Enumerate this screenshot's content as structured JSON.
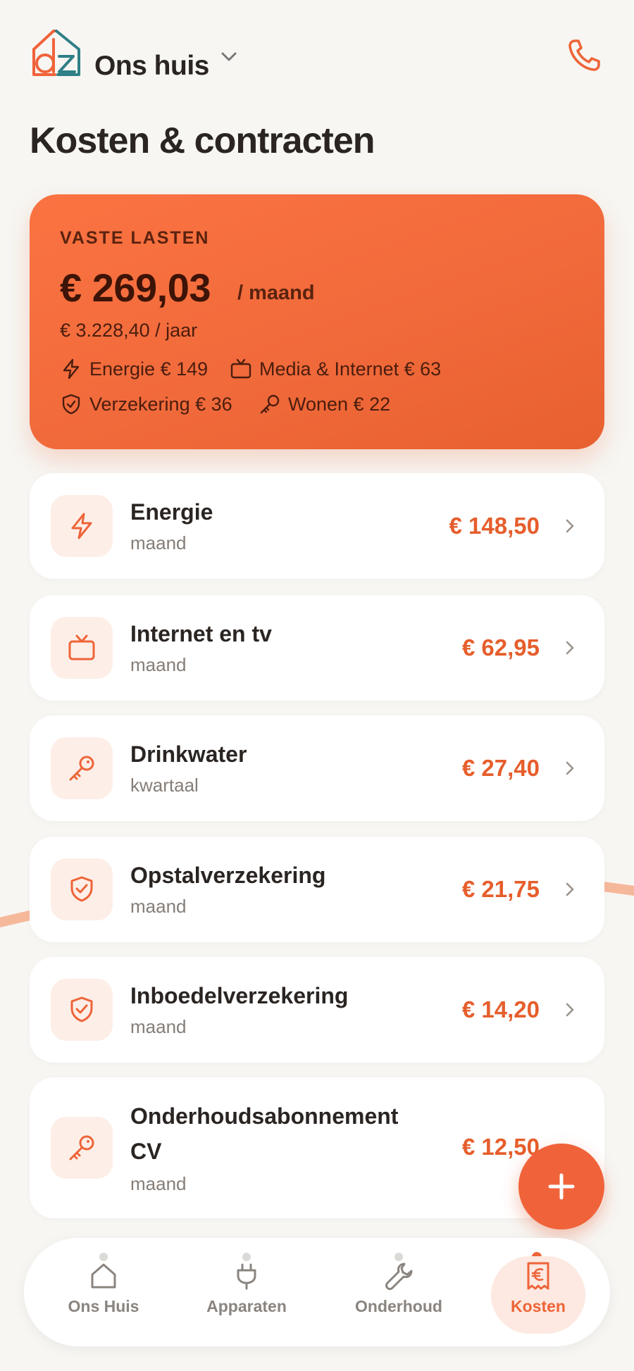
{
  "header": {
    "home_name": "Ons huis",
    "logo_letters": "dz"
  },
  "page": {
    "title": "Kosten & contracten"
  },
  "summary": {
    "label": "VASTE LASTEN",
    "amount": "€ 269,03",
    "period": "/ maand",
    "yearly": "€ 3.228,40 / jaar",
    "categories": [
      {
        "icon": "bolt-icon",
        "label": "Energie € 149"
      },
      {
        "icon": "tv-icon",
        "label": "Media & Internet € 63"
      },
      {
        "icon": "shield-icon",
        "label": "Verzekering € 36"
      },
      {
        "icon": "key-icon",
        "label": "Wonen € 22"
      }
    ]
  },
  "contracts": [
    {
      "icon": "bolt-icon",
      "title": "Energie",
      "period": "maand",
      "amount": "€ 148,50"
    },
    {
      "icon": "tv-icon",
      "title": "Internet en tv",
      "period": "maand",
      "amount": "€ 62,95"
    },
    {
      "icon": "key-icon",
      "title": "Drinkwater",
      "period": "kwartaal",
      "amount": "€ 27,40"
    },
    {
      "icon": "shield-icon",
      "title": "Opstalverzekering",
      "period": "maand",
      "amount": "€ 21,75"
    },
    {
      "icon": "shield-icon",
      "title": "Inboedelverzekering",
      "period": "maand",
      "amount": "€ 14,20"
    },
    {
      "icon": "key-icon",
      "title": "Onderhoudsabonnement CV",
      "title_line1": "Onderhoudsabonnement",
      "title_line2": "CV",
      "period": "maand",
      "amount": "€ 12,50"
    }
  ],
  "nav": [
    {
      "icon": "house-icon",
      "label": "Ons Huis",
      "active": false
    },
    {
      "icon": "plug-icon",
      "label": "Apparaten",
      "active": false
    },
    {
      "icon": "wrench-icon",
      "label": "Onderhoud",
      "active": false
    },
    {
      "icon": "receipt-euro-icon",
      "label": "Kosten",
      "active": true
    }
  ],
  "colors": {
    "accent": "#ee6438",
    "card_orange": "#f16a3b",
    "teal": "#2f7f86",
    "background": "#f7f6f3"
  }
}
